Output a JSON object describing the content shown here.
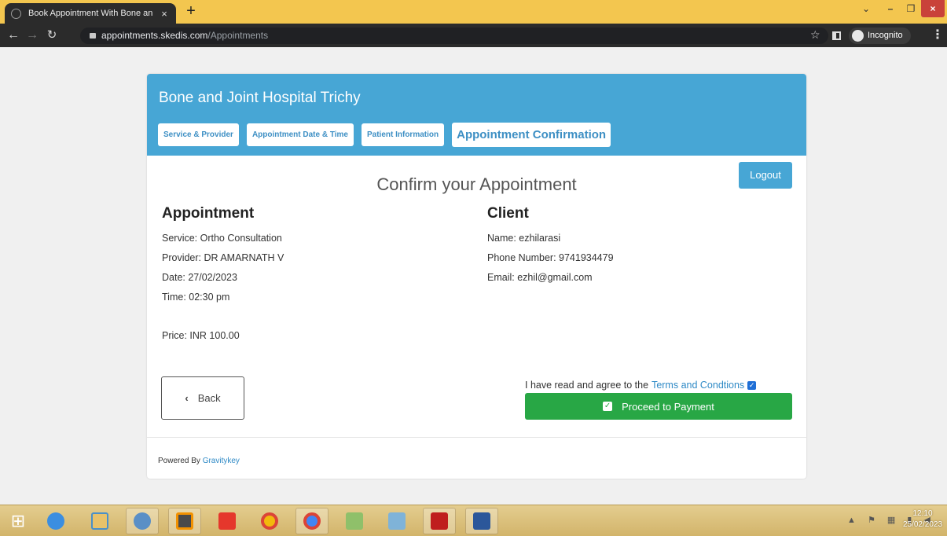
{
  "browser": {
    "tab_title": "Book Appointment With Bone an",
    "tab_close": "×",
    "new_tab": "+",
    "url_host": "appointments.skedis.com",
    "url_path": "/Appointments",
    "incognito_label": "Incognito",
    "window_controls": {
      "chevron": "⌄",
      "minimize": "–",
      "maximize": "❐",
      "close": "×"
    }
  },
  "header": {
    "hospital_name": "Bone and Joint Hospital Trichy",
    "steps": [
      {
        "label": "Service & Provider"
      },
      {
        "label": "Appointment Date & Time"
      },
      {
        "label": "Patient Information"
      },
      {
        "label": "Appointment Confirmation",
        "active": true
      }
    ]
  },
  "main": {
    "logout_label": "Logout",
    "title": "Confirm your Appointment",
    "appointment": {
      "heading": "Appointment",
      "service": "Service: Ortho Consultation",
      "provider": "Provider: DR AMARNATH V",
      "date": "Date: 27/02/2023",
      "time": "Time: 02:30 pm",
      "price": "Price: INR 100.00"
    },
    "client": {
      "heading": "Client",
      "name": "Name: ezhilarasi",
      "phone": "Phone Number: 9741934479",
      "email": "Email: ezhil@gmail.com"
    },
    "back_label": "Back",
    "terms_text": "I have read and agree to the",
    "terms_link": "Terms and Condtions",
    "terms_checked": true,
    "proceed_label": "Proceed to Payment"
  },
  "footer": {
    "powered_by": "Powered By",
    "brand": "Gravitykey"
  },
  "taskbar": {
    "time": "12:10",
    "date": "25/02/2023"
  },
  "colors": {
    "header_bg": "#47a6d5",
    "proceed_bg": "#28a745",
    "link": "#2f8ac6",
    "taskbar": "#d8bd76"
  }
}
